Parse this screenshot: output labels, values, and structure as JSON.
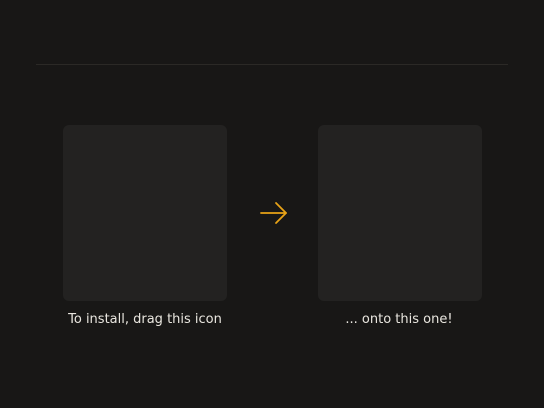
{
  "installer": {
    "source_caption": "To install, drag this icon",
    "target_caption": "... onto this one!",
    "arrow_icon": "arrow-right-icon",
    "accent_color": "#e8a317"
  }
}
